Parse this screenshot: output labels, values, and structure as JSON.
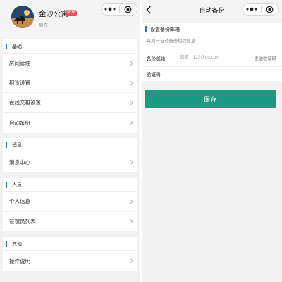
{
  "left": {
    "profile": {
      "name": "金沙公寓",
      "badge": "房东",
      "role": "房东"
    },
    "sections": [
      {
        "title": "基础",
        "items": [
          "房间管理",
          "租赁设置",
          "在线交租设置",
          "自动备份"
        ]
      },
      {
        "title": "消息",
        "items": [
          "消息中心"
        ]
      },
      {
        "title": "人员",
        "items": [
          "个人信息",
          "管理员列表"
        ]
      },
      {
        "title": "其他",
        "items": [
          "操作说明"
        ]
      }
    ]
  },
  "right": {
    "nav": {
      "title": "自动备份"
    },
    "card": {
      "title": "设置备份邮箱",
      "desc": "每周一自动备份租约信息",
      "email": {
        "label": "备份邮箱",
        "value": "",
        "placeholder": "邮箱：123@qq.com",
        "send_code": "发送验证码"
      },
      "code": {
        "label": "验证码",
        "value": "",
        "placeholder": ""
      }
    },
    "save_label": "保存"
  },
  "colors": {
    "accent_bar": "#2f6fdc",
    "save_button": "#1c9a83",
    "badge": "#e9505a"
  },
  "icons": {
    "chevron": "chevron-right-icon",
    "back": "chevron-left-icon",
    "menu": "more-dots-icon",
    "close": "target-circle-icon"
  }
}
